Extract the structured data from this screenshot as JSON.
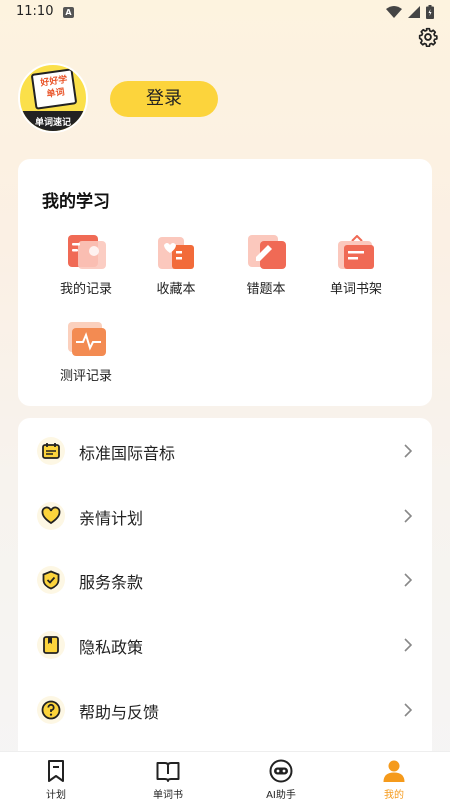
{
  "status_bar": {
    "time": "11:10",
    "badge": "A"
  },
  "profile": {
    "avatar_title": "好好学\n单词",
    "avatar_band": "单词速记",
    "login_label": "登录"
  },
  "study": {
    "title": "我的学习",
    "items": [
      {
        "label": "我的记录",
        "icon": "record-icon"
      },
      {
        "label": "收藏本",
        "icon": "favorites-icon"
      },
      {
        "label": "错题本",
        "icon": "mistakes-icon"
      },
      {
        "label": "单词书架",
        "icon": "bookshelf-icon"
      },
      {
        "label": "测评记录",
        "icon": "assessment-icon"
      }
    ]
  },
  "menu": [
    {
      "label": "标准国际音标",
      "icon": "phonetic-icon"
    },
    {
      "label": "亲情计划",
      "icon": "heart-icon"
    },
    {
      "label": "服务条款",
      "icon": "shield-icon"
    },
    {
      "label": "隐私政策",
      "icon": "privacy-icon"
    },
    {
      "label": "帮助与反馈",
      "icon": "help-icon"
    }
  ],
  "tabs": [
    {
      "label": "计划",
      "icon": "plan-icon"
    },
    {
      "label": "单词书",
      "icon": "book-icon"
    },
    {
      "label": "AI助手",
      "icon": "ai-icon"
    },
    {
      "label": "我的",
      "icon": "profile-icon"
    }
  ],
  "colors": {
    "accent": "#fcd43c",
    "active_tab": "#f59a1b",
    "icon_red": "#f06a55"
  }
}
